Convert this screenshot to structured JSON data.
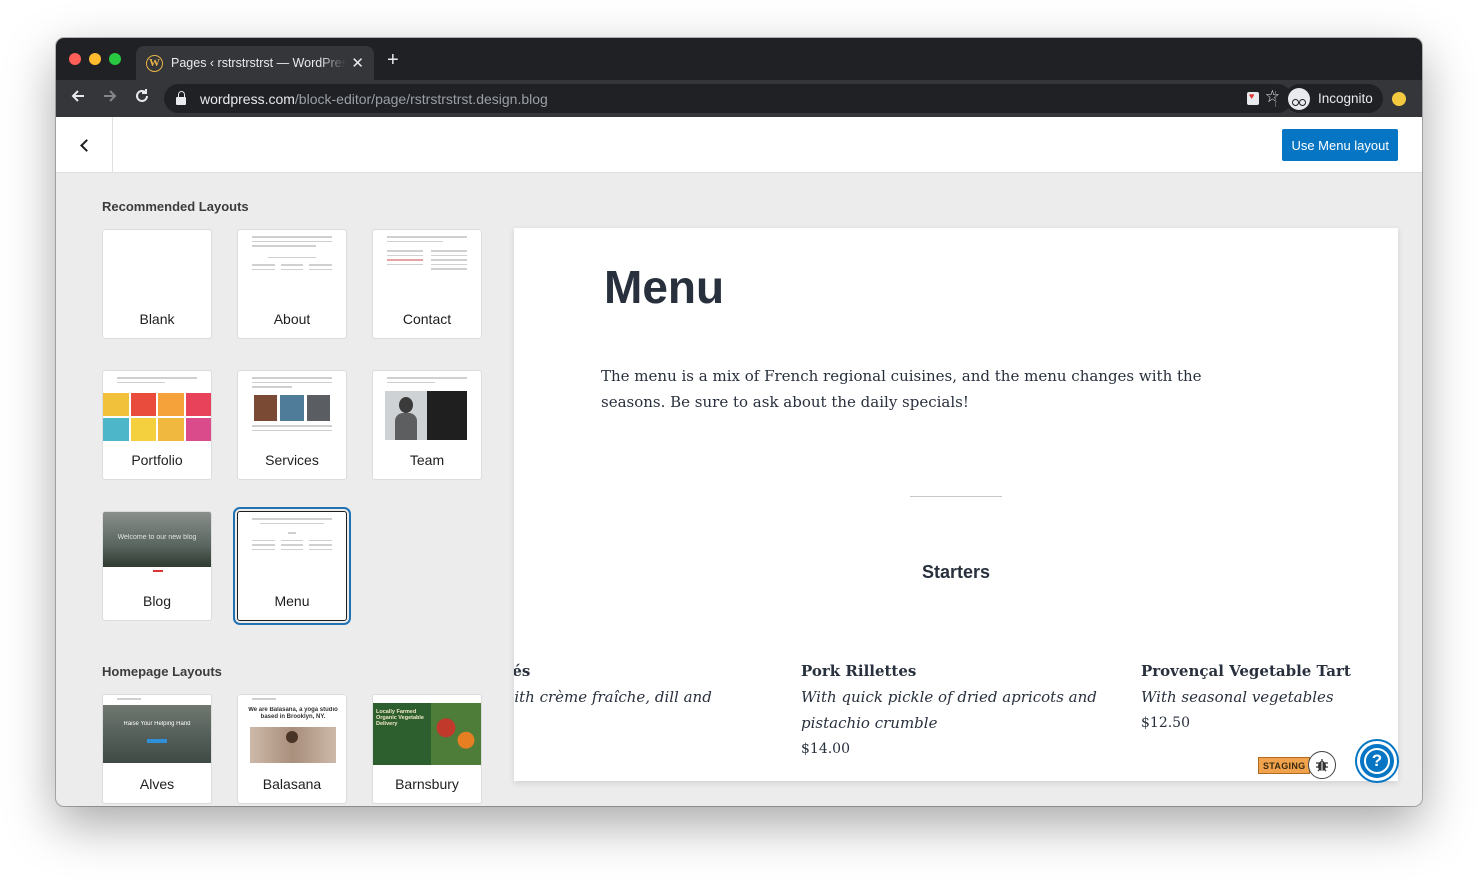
{
  "browser": {
    "tab_title": "Pages ‹ rstrstrstrst — WordPress.com",
    "new_tab_symbol": "+",
    "close_symbol": "✕",
    "url_host": "wordpress.com",
    "url_path": "/block-editor/page/rstrstrstrst.design.blog",
    "incognito_label": "Incognito"
  },
  "header": {
    "use_layout_label": "Use Menu layout"
  },
  "recommended": {
    "title": "Recommended Layouts",
    "cards": [
      {
        "label": "Blank"
      },
      {
        "label": "About"
      },
      {
        "label": "Contact"
      },
      {
        "label": "Portfolio"
      },
      {
        "label": "Services"
      },
      {
        "label": "Team"
      },
      {
        "label": "Blog",
        "thumb_text": "Welcome to our new blog"
      },
      {
        "label": "Menu",
        "selected": true
      }
    ]
  },
  "homepage": {
    "title": "Homepage Layouts",
    "cards": [
      {
        "label": "Alves",
        "thumb_text": "Raise Your Helping Hand"
      },
      {
        "label": "Balasana",
        "thumb_text": "We are Balasana, a yoga studio based in Brooklyn, NY."
      },
      {
        "label": "Barnsbury",
        "thumb_text": "Locally Farmed Organic Vegetable Delivery"
      }
    ]
  },
  "preview": {
    "title": "Menu",
    "intro": "The menu is a mix of French regional cuisines, and the menu changes with the seasons. Be sure to ask about the daily specials!",
    "section": "Starters",
    "items": [
      {
        "name": "Smoked Salmon Canapés",
        "desc": "Smoked salmon topped with crème fraîche, dill and capers",
        "price": ""
      },
      {
        "name": "Pork Rillettes",
        "desc": "With quick pickle of dried apricots and pistachio crumble",
        "price": "$14.00"
      },
      {
        "name": "Provençal Vegetable Tart",
        "desc": "With seasonal vegetables",
        "price": "$12.50"
      }
    ]
  },
  "badges": {
    "staging": "STAGING",
    "help": "?"
  },
  "colors": {
    "primary": "#0675c4",
    "chrome_dark": "#202124",
    "chrome_toolbar": "#35363a",
    "staging": "#f0a24c"
  }
}
